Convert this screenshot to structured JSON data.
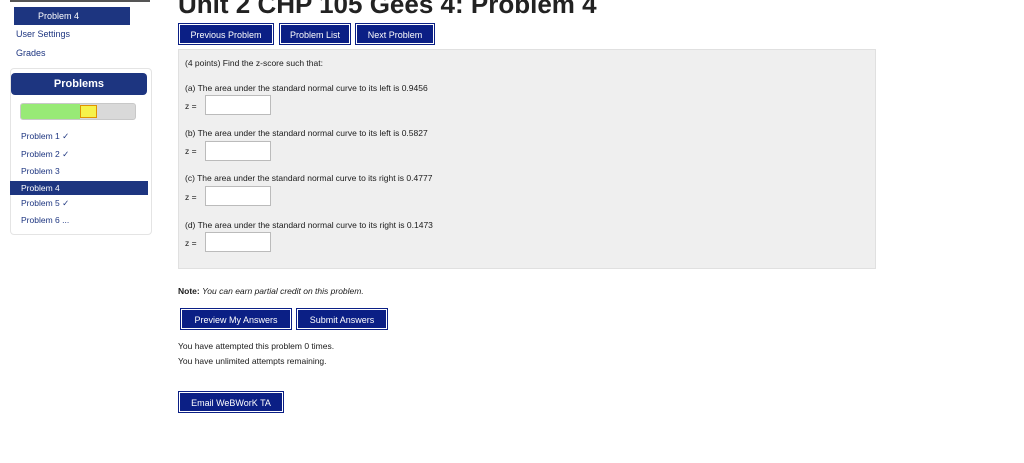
{
  "page": {
    "heading": "Unit 2 CHP 105 Gees 4: Problem 4"
  },
  "sidebar": {
    "active_problem": "Problem 4",
    "links": [
      "User Settings",
      "Grades"
    ],
    "panel_title": "Problems",
    "progress": {
      "correct_fraction": 0.52,
      "partial_fraction": 0.15
    },
    "problems": [
      {
        "label": "Problem 1 ✓",
        "active": false
      },
      {
        "label": "Problem 2 ✓",
        "active": false
      },
      {
        "label": "Problem 3",
        "active": false
      },
      {
        "label": "Problem 4",
        "active": true
      },
      {
        "label": "Problem 5 ✓",
        "active": false
      },
      {
        "label": "Problem 6 ...",
        "active": false
      }
    ]
  },
  "nav": {
    "prev": "Previous Problem",
    "list": "Problem List",
    "next": "Next Problem"
  },
  "problem": {
    "intro": "(4 points) Find the z-score such that:",
    "parts": [
      {
        "text": "(a) The area under the standard normal curve to its left is 0.9456",
        "label": "z =",
        "value": ""
      },
      {
        "text": "(b) The area under the standard normal curve to its left is 0.5827",
        "label": "z =",
        "value": ""
      },
      {
        "text": "(c) The area under the standard normal curve to its right is 0.4777",
        "label": "z =",
        "value": ""
      },
      {
        "text": "(d) The area under the standard normal curve to its right is 0.1473",
        "label": "z =",
        "value": ""
      }
    ]
  },
  "note": {
    "label": "Note:",
    "text": "You can earn partial credit on this problem."
  },
  "actions": {
    "preview": "Preview My Answers",
    "submit": "Submit Answers"
  },
  "attempts": {
    "line1": "You have attempted this problem 0 times.",
    "line2": "You have unlimited attempts remaining."
  },
  "email": "Email WeBWorK TA",
  "colors": {
    "primary": "#1d3580",
    "button": "#0b1f85",
    "progress_correct": "#98ea76",
    "progress_partial": "#f6f24a"
  }
}
